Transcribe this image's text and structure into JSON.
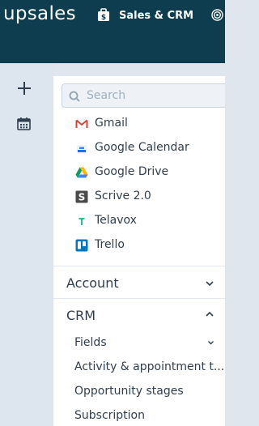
{
  "header": {
    "brand": "upsales",
    "product_label": "Sales & CRM",
    "icons": [
      "briefcase-icon",
      "radar-icon"
    ],
    "background_color": "#0d3d4f"
  },
  "rail": {
    "icons": [
      "plus-icon",
      "calendar-icon"
    ]
  },
  "search": {
    "placeholder": "Search"
  },
  "apps": [
    {
      "label": "Gmail",
      "icon": "gmail-icon"
    },
    {
      "label": "Google Calendar",
      "icon": "google-calendar-icon"
    },
    {
      "label": "Google Drive",
      "icon": "google-drive-icon"
    },
    {
      "label": "Scrive 2.0",
      "icon": "scrive-icon"
    },
    {
      "label": "Telavox",
      "icon": "telavox-icon"
    },
    {
      "label": "Trello",
      "icon": "trello-icon"
    }
  ],
  "sections": {
    "account": {
      "label": "Account",
      "expanded": false
    },
    "crm": {
      "label": "CRM",
      "expanded": true
    }
  },
  "crm_items": {
    "fields": "Fields",
    "activity": "Activity & appointment t...",
    "opportunity": "Opportunity stages",
    "subscription": "Subscription"
  }
}
